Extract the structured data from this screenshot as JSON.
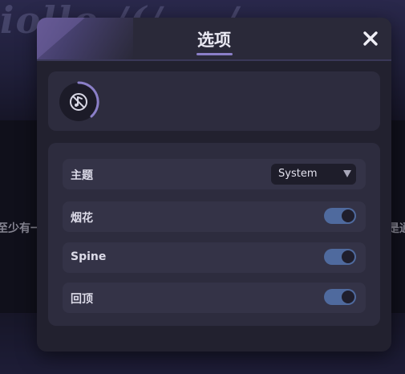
{
  "background": {
    "logo_text": "iollo /(/ ~ /",
    "left_fragment": "至少有一",
    "right_fragment": "是通"
  },
  "dialog": {
    "title": "选项",
    "close_icon": "close-icon",
    "avatar_icon": "no-music-icon"
  },
  "settings": {
    "theme": {
      "label": "主题",
      "value": "System"
    },
    "fireworks": {
      "label": "烟花",
      "on": true
    },
    "spine": {
      "label": "Spine",
      "on": true
    },
    "recap": {
      "label": "回顶",
      "on": true
    }
  },
  "colors": {
    "accent": "#8b7fc8",
    "toggle_on": "#4f6a9e",
    "panel": "#22212f",
    "card": "#2d2c3e"
  }
}
